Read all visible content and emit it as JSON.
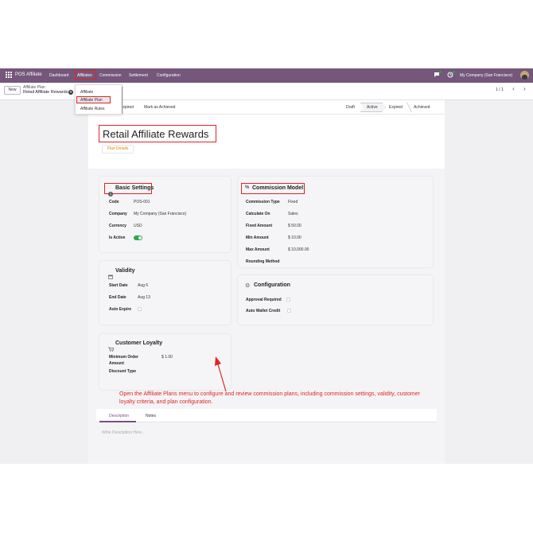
{
  "navbar": {
    "app_name": "POS Affiliate",
    "menus": [
      "Dashboard",
      "Affiliates",
      "Commission",
      "Settlement",
      "Configuration"
    ],
    "company": "My Company (San Francisco)"
  },
  "dropdown": {
    "items": [
      "Affiliate",
      "Affiliate Plan",
      "Affiliate Rules"
    ],
    "selected": "Affiliate Plan"
  },
  "control": {
    "new_label": "New",
    "breadcrumb_parent": "Affiliate Plan",
    "breadcrumb_current": "Retail Affiliate Rewards",
    "pager": "1 / 1"
  },
  "statusbar": {
    "buttons": [
      "Expired",
      "Mark as Achieved"
    ],
    "stages": [
      "Draft",
      "Active",
      "Expired",
      "Achieved"
    ],
    "active_stage": "Active"
  },
  "form": {
    "title": "Retail Affiliate Rewards",
    "tab": "Plan Details",
    "basic": {
      "heading": "Basic Settings",
      "rows": [
        {
          "label": "Code",
          "value": "POS-001"
        },
        {
          "label": "Company",
          "value": "My Company (San Francisco)"
        },
        {
          "label": "Currency",
          "value": "USD"
        },
        {
          "label": "Is Active",
          "value": ""
        }
      ],
      "is_active": true
    },
    "validity": {
      "heading": "Validity",
      "rows": [
        {
          "label": "Start Date",
          "value": "Aug 6"
        },
        {
          "label": "End Date",
          "value": "Aug 13"
        },
        {
          "label": "Auto Expire",
          "value": ""
        }
      ]
    },
    "loyalty": {
      "heading": "Customer Loyalty",
      "min_order_label": "Minimum Order",
      "min_order_label2": "Amount",
      "min_order_value": "$ 1.00",
      "discount_label": "Discount Type"
    },
    "commission": {
      "heading": "Commission Model",
      "rows": [
        {
          "label": "Commission Type",
          "value": "Fixed"
        },
        {
          "label": "Calculate On",
          "value": "Sales"
        },
        {
          "label": "Fixed Amount",
          "value": "$ 50.00"
        },
        {
          "label": "Min Amount",
          "value": "$ 10.00"
        },
        {
          "label": "Max Amount",
          "value": "$ 10,000.00"
        },
        {
          "label": "Rounding Method",
          "value": ""
        }
      ]
    },
    "configuration": {
      "heading": "Configuration",
      "rows": [
        {
          "label": "Approval Required",
          "value": ""
        },
        {
          "label": "Auto Wallet Credit",
          "value": ""
        }
      ]
    },
    "notebook": {
      "tabs": [
        "Description",
        "Notes"
      ],
      "active": "Description",
      "placeholder": "Write Description Here.."
    }
  },
  "annotation": "Open the Affiliate Plans menu to configure and review commission plans, including commission settings, validity, customer loyalty criteria, and plan configuration.",
  "colors": {
    "navbar": "#74577a",
    "highlight": "#e02424",
    "toggle": "#2ba84a",
    "tab_active": "#7a4f86"
  }
}
